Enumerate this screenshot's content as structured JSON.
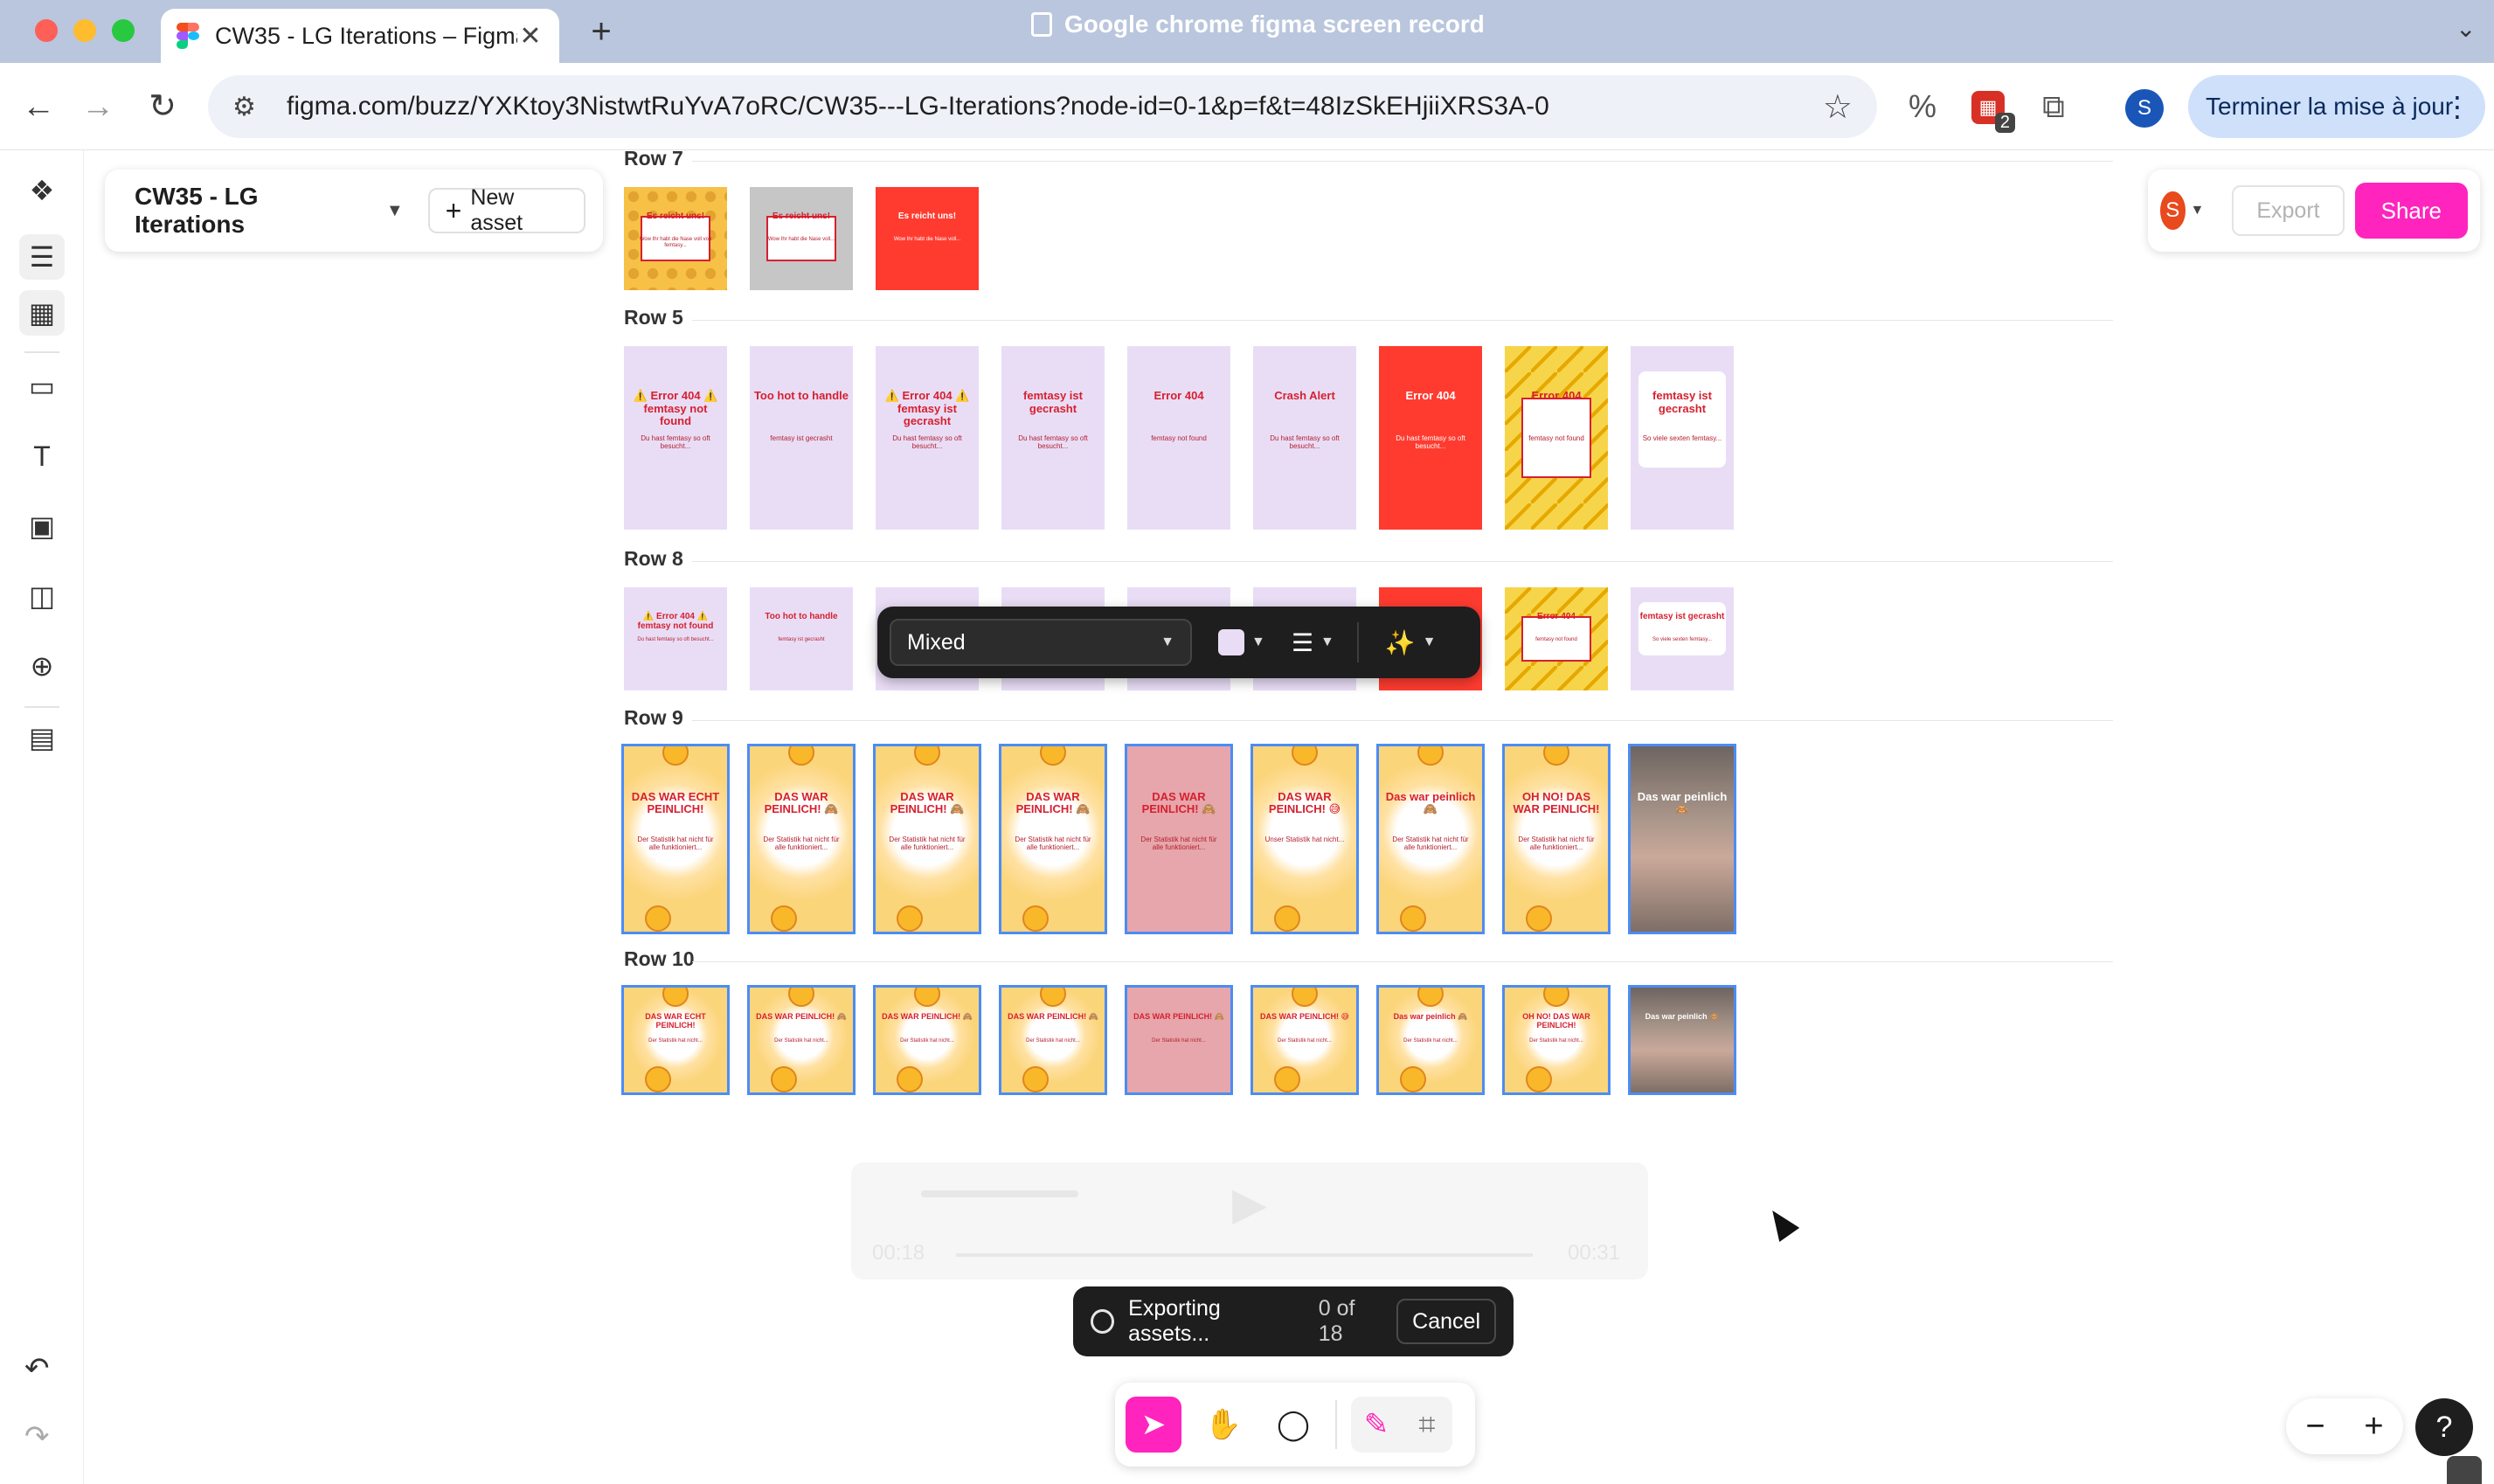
{
  "browser": {
    "tab_title": "CW35 - LG Iterations – Figma",
    "tab_close": "✕",
    "new_tab": "+",
    "window_title": "Google chrome figma screen record",
    "url": "figma.com/buzz/YXKtoy3NistwtRuYvA7oRC/CW35---LG-Iterations?node-id=0-1&p=f&t=48IzSkEHjiiXRS3A-0",
    "profile_initial": "S",
    "update_label": "Terminer la mise à jour",
    "extension_badge": "2"
  },
  "figma": {
    "file_name": "CW35 - LG Iterations",
    "new_asset_label": "New asset",
    "avatar_initial": "S",
    "export_label": "Export",
    "share_label": "Share",
    "share_color": "#ff24bd",
    "rows": [
      {
        "label": "Row 7",
        "frames": [
          {
            "texts": [
              "Es reicht uns!",
              "Wow Ihr habt die Nase voll von femtasy..."
            ]
          },
          {
            "texts": [
              "Es reicht uns!",
              "Wow Ihr habt die Nase voll..."
            ]
          },
          {
            "texts": [
              "Es reicht uns!",
              "Wow Ihr habt die Nase voll..."
            ]
          }
        ]
      },
      {
        "label": "Row 5",
        "frames": [
          {
            "texts": [
              "⚠️ Error 404 ⚠️ femtasy not found",
              "Du hast femtasy so oft besucht..."
            ]
          },
          {
            "texts": [
              "Too hot to handle",
              "femtasy ist gecrasht"
            ]
          },
          {
            "texts": [
              "⚠️ Error 404 ⚠️ femtasy ist gecrasht",
              "Du hast femtasy so oft besucht..."
            ]
          },
          {
            "texts": [
              "femtasy ist gecrasht",
              "Du hast femtasy so oft besucht..."
            ]
          },
          {
            "texts": [
              "Error 404",
              "femtasy not found"
            ]
          },
          {
            "texts": [
              "Crash Alert",
              "Du hast femtasy so oft besucht..."
            ]
          },
          {
            "texts": [
              "Error 404",
              "Du hast femtasy so oft besucht..."
            ]
          },
          {
            "texts": [
              "Error 404",
              "femtasy not found"
            ]
          },
          {
            "texts": [
              "femtasy ist gecrasht",
              "So viele sexten femtasy..."
            ]
          }
        ]
      },
      {
        "label": "Row 8",
        "frames": [
          {
            "texts": [
              "⚠️ Error 404 ⚠️ femtasy not found",
              "Du hast femtasy so oft besucht..."
            ]
          },
          {
            "texts": [
              "Too hot to handle",
              "femtasy ist gecrasht"
            ]
          },
          {
            "texts": [
              "",
              ""
            ]
          },
          {
            "texts": [
              "",
              ""
            ]
          },
          {
            "texts": [
              "Error 404",
              ""
            ]
          },
          {
            "texts": [
              "",
              ""
            ]
          },
          {
            "texts": [
              "",
              ""
            ]
          },
          {
            "texts": [
              "Error 404",
              "femtasy not found"
            ]
          },
          {
            "texts": [
              "femtasy ist gecrasht",
              "So viele sexten femtasy..."
            ]
          }
        ]
      },
      {
        "label": "Row 9",
        "frames": [
          {
            "texts": [
              "DAS WAR ECHT PEINLICH!",
              "Der Statistik hat nicht für alle funktioniert..."
            ]
          },
          {
            "texts": [
              "DAS WAR PEINLICH! 🙈",
              "Der Statistik hat nicht für alle funktioniert..."
            ]
          },
          {
            "texts": [
              "DAS WAR PEINLICH! 🙈",
              "Der Statistik hat nicht für alle funktioniert..."
            ]
          },
          {
            "texts": [
              "DAS WAR PEINLICH! 🙈",
              "Der Statistik hat nicht für alle funktioniert..."
            ]
          },
          {
            "texts": [
              "DAS WAR PEINLICH! 🙈",
              "Der Statistik hat nicht für alle funktioniert..."
            ]
          },
          {
            "texts": [
              "DAS WAR PEINLICH! 😅",
              "Unser Statistik hat nicht..."
            ]
          },
          {
            "texts": [
              "Das war peinlich 🙈",
              "Der Statistik hat nicht für alle funktioniert..."
            ]
          },
          {
            "texts": [
              "OH NO! DAS WAR PEINLICH!",
              "Der Statistik hat nicht für alle funktioniert..."
            ]
          },
          {
            "texts": [
              "Das war peinlich 🙈",
              ""
            ]
          }
        ]
      },
      {
        "label": "Row 10",
        "frames": [
          {
            "texts": [
              "DAS WAR ECHT PEINLICH!",
              "Der Statistik hat nicht..."
            ]
          },
          {
            "texts": [
              "DAS WAR PEINLICH! 🙈",
              "Der Statistik hat nicht..."
            ]
          },
          {
            "texts": [
              "DAS WAR PEINLICH! 🙈",
              "Der Statistik hat nicht..."
            ]
          },
          {
            "texts": [
              "DAS WAR PEINLICH! 🙈",
              "Der Statistik hat nicht..."
            ]
          },
          {
            "texts": [
              "DAS WAR PEINLICH! 🙈",
              "Der Statistik hat nicht..."
            ]
          },
          {
            "texts": [
              "DAS WAR PEINLICH! 😅",
              "Der Statistik hat nicht..."
            ]
          },
          {
            "texts": [
              "Das war peinlich 🙈",
              "Der Statistik hat nicht..."
            ]
          },
          {
            "texts": [
              "OH NO! DAS WAR PEINLICH!",
              "Der Statistik hat nicht..."
            ]
          },
          {
            "texts": [
              "Das war peinlich 🙈",
              ""
            ]
          }
        ]
      }
    ],
    "selection_toolbar": {
      "font_value": "Mixed",
      "fill_color": "#e9ddf6"
    },
    "video_overlay": {
      "time_start": "00:18",
      "time_end": "00:31"
    },
    "toast": {
      "text": "Exporting assets...",
      "count": "0 of 18",
      "cancel_label": "Cancel"
    },
    "zoom": {
      "minus": "−",
      "plus": "+"
    },
    "help_label": "?"
  }
}
